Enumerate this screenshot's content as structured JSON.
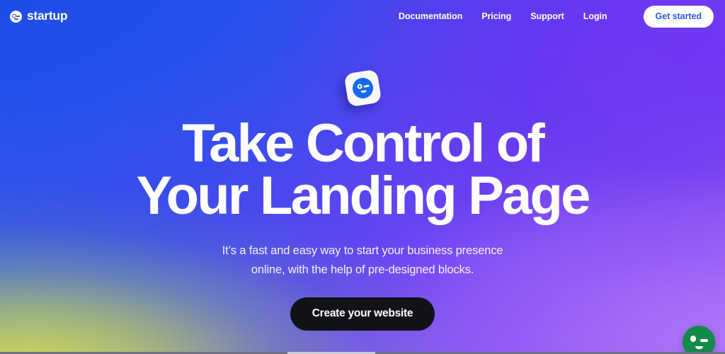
{
  "brand": {
    "name": "startup",
    "mark_icon": "key-circle-icon"
  },
  "nav": {
    "links": [
      {
        "label": "Documentation"
      },
      {
        "label": "Pricing"
      },
      {
        "label": "Support"
      },
      {
        "label": "Login"
      }
    ],
    "cta_label": "Get started"
  },
  "hero": {
    "badge_icon": "key-badge-icon",
    "headline_line1": "Take Control of",
    "headline_line2": "Your Landing Page",
    "subhead_line1": "It’s a fast and easy way to start your business presence",
    "subhead_line2": "online, with the help of pre-designed blocks.",
    "cta_label": "Create your website"
  },
  "widget": {
    "icon": "key-chat-icon"
  },
  "colors": {
    "blue": "#1d4ce7",
    "violet": "#6e36f2",
    "purple": "#ac74f8",
    "lime": "#dbe24a",
    "nav_cta_text": "#2b5ae8",
    "hero_cta_bg": "#111318",
    "widget_green": "#138a47",
    "text_white": "#ffffff"
  }
}
